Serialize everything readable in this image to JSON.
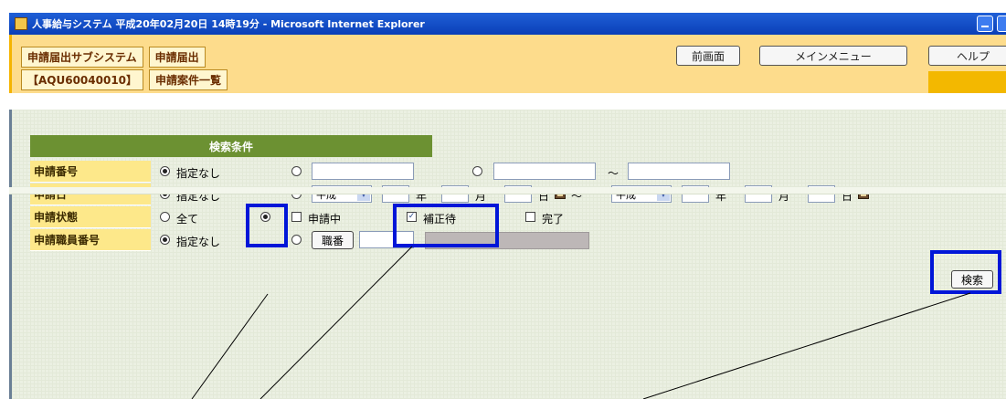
{
  "window": {
    "title": "人事給与システム 平成20年02月20日 14時19分 - Microsoft Internet Explorer"
  },
  "header": {
    "subsystem": "申請届出サブシステム",
    "module": "申請届出",
    "screen_id": "【AQU60040010】",
    "screen_name": "申請案件一覧",
    "buttons": {
      "prev": "前画面",
      "main_menu": "メインメニュー",
      "help": "ヘルプ"
    }
  },
  "search": {
    "title": "検索条件",
    "fields": {
      "number": {
        "label": "申請番号",
        "option_none": "指定なし",
        "range_sep": "～"
      },
      "date": {
        "label": "申請日",
        "option_none": "指定なし",
        "era": "平成",
        "year": "年",
        "month": "月",
        "day": "日",
        "range_sep": "～"
      },
      "status": {
        "label": "申請状態",
        "all": "全て",
        "options": [
          "申請中",
          "補正待",
          "完了"
        ],
        "checked": [
          false,
          true,
          false
        ]
      },
      "staff": {
        "label": "申請職員番号",
        "option_none": "指定なし",
        "lookup": "職番"
      }
    },
    "search_button": "検索"
  }
}
